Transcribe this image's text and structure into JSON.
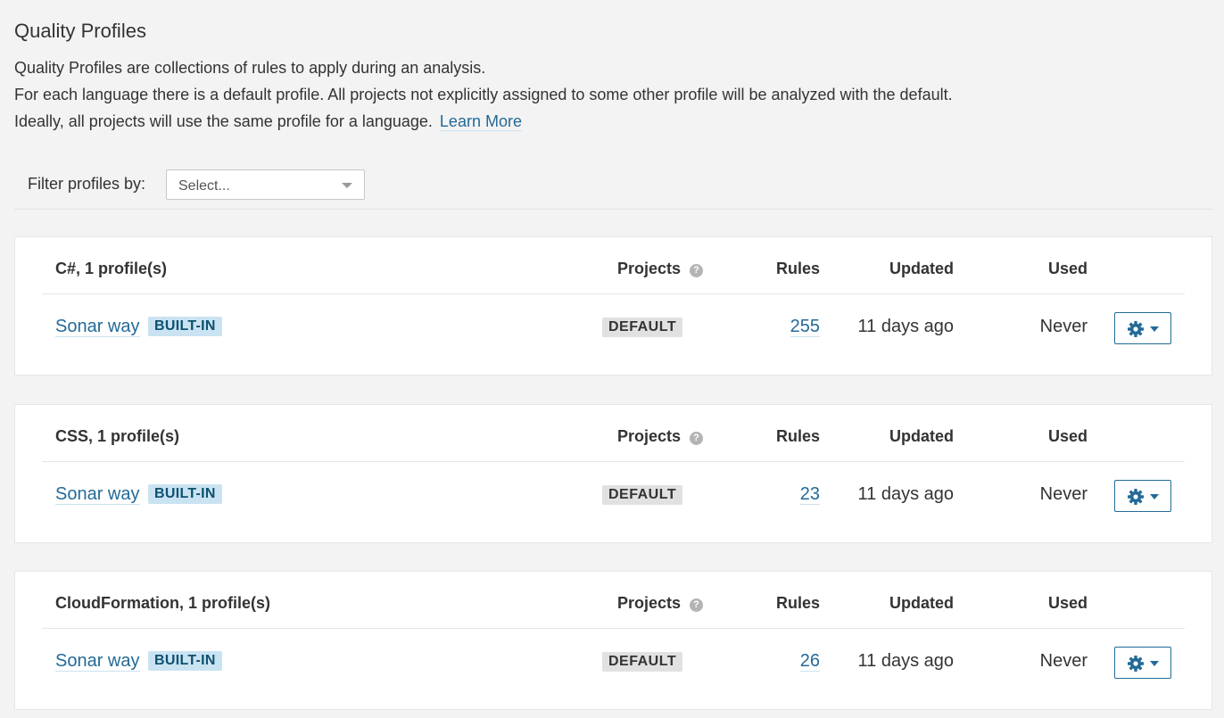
{
  "page": {
    "title": "Quality Profiles",
    "description": [
      "Quality Profiles are collections of rules to apply during an analysis.",
      "For each language there is a default profile. All projects not explicitly assigned to some other profile will be analyzed with the default.",
      "Ideally, all projects will use the same profile for a language."
    ],
    "learn_more": "Learn More"
  },
  "filter": {
    "label": "Filter profiles by:",
    "placeholder": "Select..."
  },
  "columns": {
    "projects": "Projects",
    "help": "?",
    "rules": "Rules",
    "updated": "Updated",
    "used": "Used"
  },
  "groups": [
    {
      "heading": "C#, 1 profile(s)",
      "profile": {
        "name": "Sonar way",
        "builtin": "BUILT-IN",
        "projects": "DEFAULT",
        "rules": "255",
        "updated": "11 days ago",
        "used": "Never"
      }
    },
    {
      "heading": "CSS, 1 profile(s)",
      "profile": {
        "name": "Sonar way",
        "builtin": "BUILT-IN",
        "projects": "DEFAULT",
        "rules": "23",
        "updated": "11 days ago",
        "used": "Never"
      }
    },
    {
      "heading": "CloudFormation, 1 profile(s)",
      "profile": {
        "name": "Sonar way",
        "builtin": "BUILT-IN",
        "projects": "DEFAULT",
        "rules": "26",
        "updated": "11 days ago",
        "used": "Never"
      }
    }
  ],
  "colors": {
    "link": "#236a97",
    "builtin_bg": "#cae3f2",
    "default_bg": "#e1e1e1",
    "page_bg": "#f3f3f3"
  },
  "icons": {
    "actions": "gear-icon",
    "help": "help-circle-icon",
    "dropdown": "chevron-down-icon"
  }
}
